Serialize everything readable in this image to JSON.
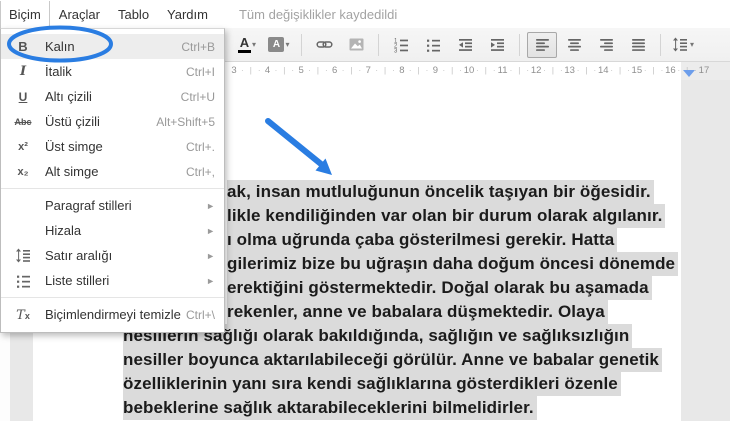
{
  "menu_bar": {
    "items": [
      {
        "id": "format",
        "label": "Biçim",
        "open": true
      },
      {
        "id": "tools",
        "label": "Araçlar",
        "open": false
      },
      {
        "id": "table",
        "label": "Tablo",
        "open": false
      },
      {
        "id": "help",
        "label": "Yardım",
        "open": false
      }
    ],
    "status": "Tüm değişiklikler kaydedildi"
  },
  "format_menu": {
    "items": [
      {
        "id": "bold",
        "icon": "bold",
        "label": "Kalın",
        "shortcut": "Ctrl+B",
        "hover": true,
        "circled": true
      },
      {
        "id": "italic",
        "icon": "italic",
        "label": "İtalik",
        "shortcut": "Ctrl+I"
      },
      {
        "id": "underline",
        "icon": "underline",
        "label": "Altı çizili",
        "shortcut": "Ctrl+U"
      },
      {
        "id": "strikethrough",
        "icon": "strikethrough",
        "label": "Üstü çizili",
        "shortcut": "Alt+Shift+5"
      },
      {
        "id": "superscript",
        "icon": "superscript",
        "label": "Üst simge",
        "shortcut": "Ctrl+."
      },
      {
        "id": "subscript",
        "icon": "subscript",
        "label": "Alt simge",
        "shortcut": "Ctrl+,"
      },
      {
        "type": "separator"
      },
      {
        "id": "paragraph-styles",
        "label": "Paragraf stilleri",
        "submenu": true
      },
      {
        "id": "align",
        "label": "Hizala",
        "submenu": true
      },
      {
        "id": "line-spacing",
        "icon": "line-spacing",
        "label": "Satır aralığı",
        "submenu": true
      },
      {
        "id": "list-styles",
        "icon": "list",
        "label": "Liste stilleri",
        "submenu": true
      },
      {
        "type": "separator"
      },
      {
        "id": "clear-formatting",
        "icon": "clear-formatting",
        "label": "Biçimlendirmeyi temizle",
        "shortcut": "Ctrl+\\"
      }
    ]
  },
  "toolbar": {
    "items": [
      {
        "name": "text-color",
        "caret": true
      },
      {
        "name": "highlight-color",
        "caret": true
      },
      {
        "sep": true
      },
      {
        "name": "insert-link"
      },
      {
        "name": "insert-image"
      },
      {
        "sep": true
      },
      {
        "name": "numbered-list"
      },
      {
        "name": "bulleted-list"
      },
      {
        "name": "decrease-indent"
      },
      {
        "name": "increase-indent"
      },
      {
        "sep": true
      },
      {
        "name": "align-left",
        "pressed": true
      },
      {
        "name": "align-center"
      },
      {
        "name": "align-right"
      },
      {
        "name": "justify"
      },
      {
        "sep": true
      },
      {
        "name": "line-spacing",
        "caret": true
      }
    ]
  },
  "ruler": {
    "numbers": [
      3,
      4,
      5,
      6,
      7,
      8,
      9,
      10,
      11,
      12,
      13,
      14,
      15,
      16,
      17
    ],
    "indent_marker": "right-indent"
  },
  "document": {
    "selection_highlighted": true,
    "clipped_lines": [
      "ak, insan mutluluğunun öncelik taşıyan bir öğesidir.",
      "likle kendiliğinden var olan bir durum olarak algılanır.",
      "ı olma uğrunda çaba gösterilmesi gerekir. Hatta",
      "gilerimiz bize bu uğraşın daha doğum öncesi dönemde",
      "erektiğini göstermektedir. Doğal olarak bu aşamada",
      "rekenler, anne ve babalara düşmektedir. Olaya",
      "nesillerin sağlığı olarak bakıldığında, sağlığın ve sağlıksızlığın",
      "nesiller boyunca aktarılabileceği görülür. Anne ve babalar genetik",
      "özelliklerinin yanı sıra kendi sağlıklarına gösterdikleri özenle",
      "bebeklerine sağlık aktarabileceklerini bilmelidirler."
    ],
    "clipped_count": 6
  },
  "annotations": {
    "color": "#2a7de2",
    "ellipse_target": "Kalın menu item",
    "arrow_target": "selected paragraph"
  },
  "colors": {
    "selection_highlight": "#dbdbdb",
    "canvas": "#e8e8e8",
    "indent_marker_blue": "#6d9eeb"
  }
}
